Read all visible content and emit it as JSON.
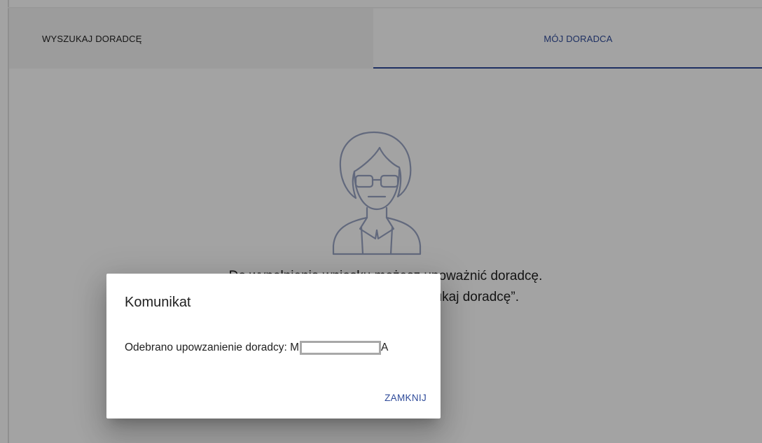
{
  "tabs": {
    "search_label": "WYSZUKAJ DORADCĘ",
    "mine_label": "MÓJ DORADCA"
  },
  "empty_state": {
    "line1": "Do wypełnienia wniosku możesz upoważnić doradcę.",
    "line2": "Znajdź go w zakładce “Wyszukaj doradcę”."
  },
  "dialog": {
    "title": "Komunikat",
    "message_prefix": "Odebrano upowzanienie doradcy: M",
    "message_suffix": "A",
    "close_label": "ZAMKNIJ"
  },
  "colors": {
    "accent": "#2f4b9a",
    "overlay": "rgba(0,0,0,0.36)",
    "illustration_stroke": "#9aa5c4"
  },
  "icons": {
    "illustration": "advisor-person-icon"
  }
}
